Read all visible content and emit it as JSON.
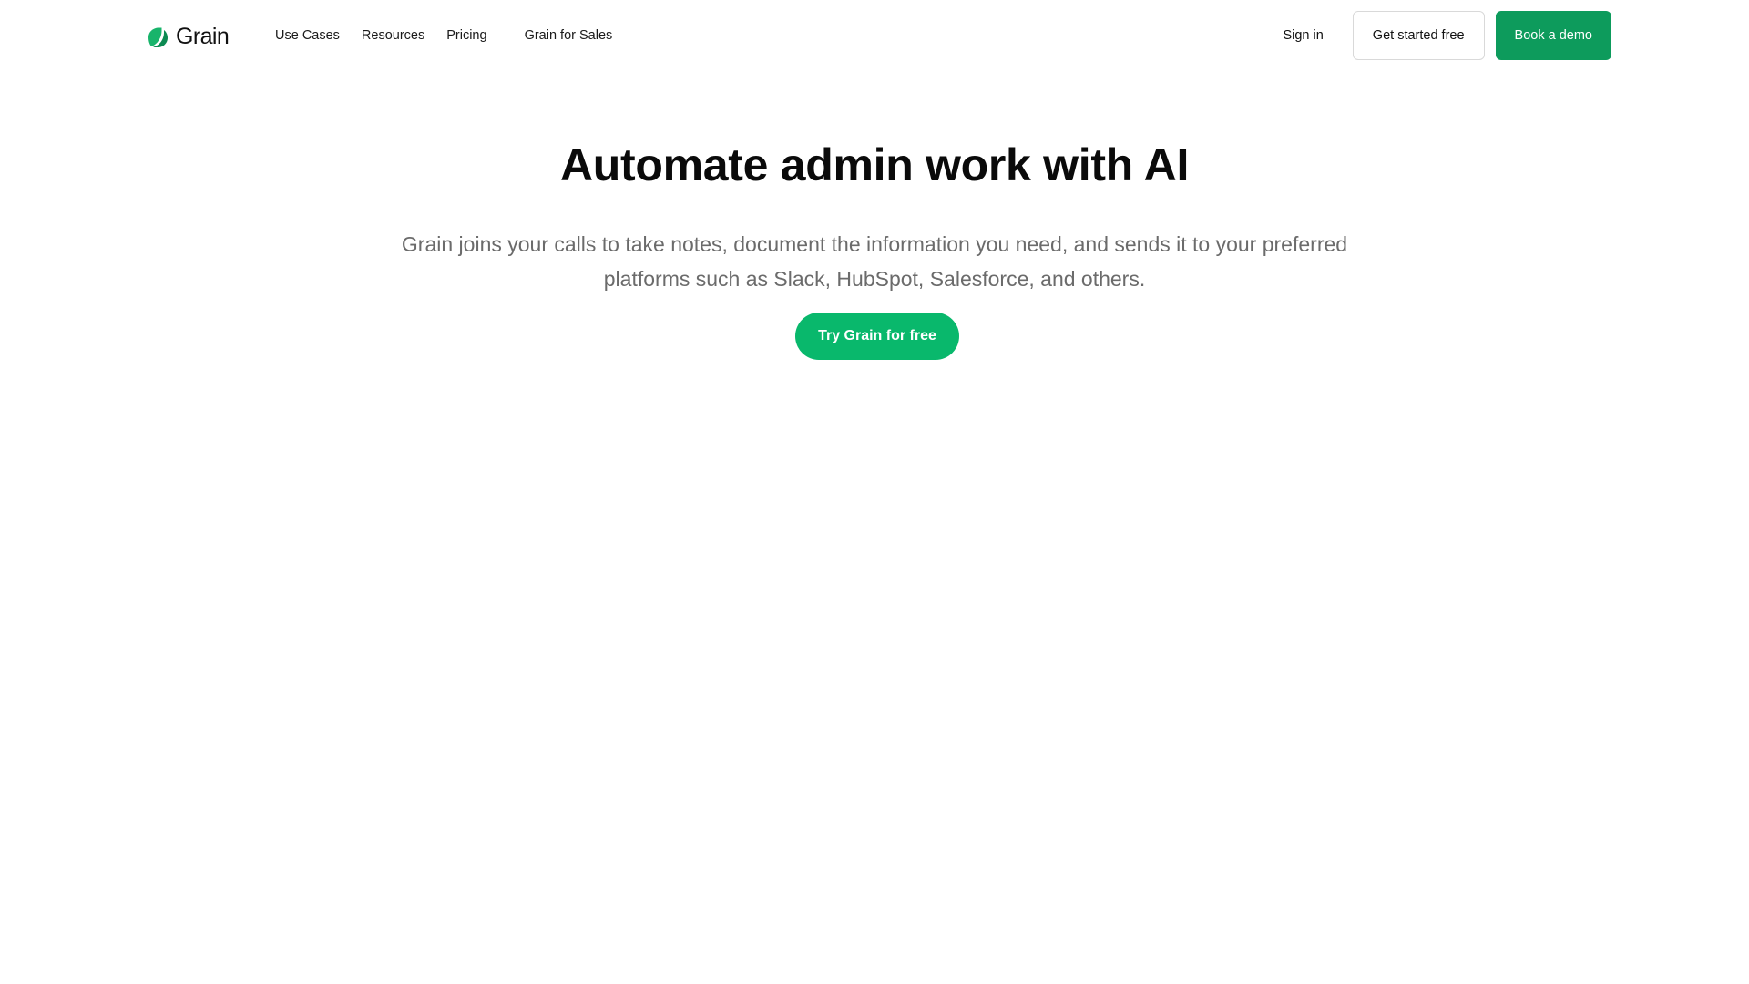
{
  "brand": {
    "name": "Grain",
    "logo_icon": "leaf-icon",
    "color": "#0d9b5c"
  },
  "nav": {
    "links": [
      {
        "label": "Use Cases"
      },
      {
        "label": "Resources"
      },
      {
        "label": "Pricing"
      }
    ],
    "secondary_link": "Grain for Sales",
    "sign_in": "Sign in",
    "get_started": "Get started free",
    "book_demo": "Book a demo"
  },
  "hero": {
    "title": "Automate admin work with AI",
    "subtitle": "Grain joins your calls to take notes, document the information you need, and sends it to your preferred platforms such as Slack, HubSpot, Salesforce, and others.",
    "cta": "Try Grain for free",
    "cta_color": "#09b86c"
  }
}
